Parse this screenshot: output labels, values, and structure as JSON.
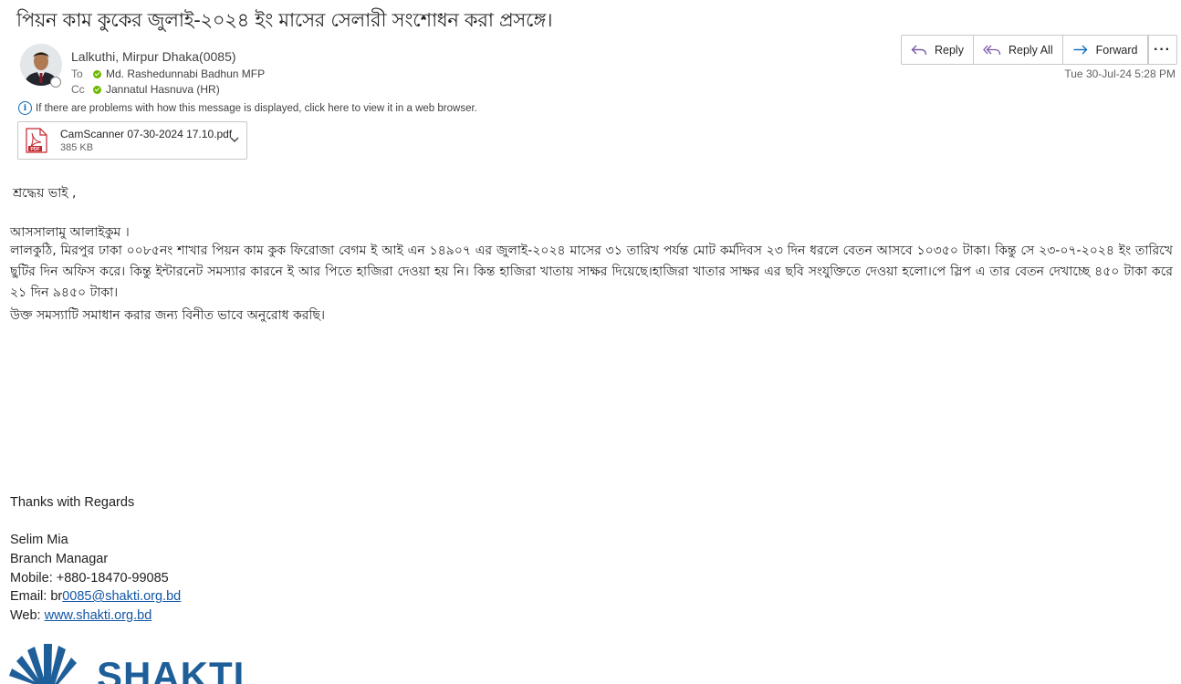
{
  "email": {
    "subject": "পিয়ন কাম কুকের জুলাই-২০২৪ ইং মাসের সেলারী সংশোধন করা প্রসঙ্গে।",
    "sender": "Lalkuthi, Mirpur Dhaka(0085)",
    "to_label": "To",
    "to": "Md. Rashedunnabi Badhun MFP",
    "cc_label": "Cc",
    "cc": "Jannatul Hasnuva (HR)",
    "date": "Tue 30-Jul-24 5:28 PM",
    "info_bar": "If there are problems with how this message is displayed, click here to view it in a web browser."
  },
  "actions": {
    "reply": "Reply",
    "reply_all": "Reply All",
    "forward": "Forward",
    "more": "···"
  },
  "attachment": {
    "name": "CamScanner 07-30-2024 17.10.pdf",
    "size": "385 KB",
    "badge": "PDF"
  },
  "body": {
    "salutation": "শ্রদ্ধেয় ভাই ,",
    "greeting": "আসসালামু আলাইকুম ।",
    "paragraph": "লালকুঠি, মিরপুর ঢাকা ০০৮৫নং শাখার পিয়ন কাম কুক ফিরোজা বেগম ই আই এন ১৪৯০৭ এর জুলাই-২০২৪ মাসের ৩১ তারিখ পর্যন্ত মোট কর্মদিবস ২৩ দিন ধরলে বেতন আসবে ১০৩৫০ টাকা। কিন্তু সে ২৩-০৭-২০২৪ ইং তারিখে ছুটির দিন অফিস করে। কিন্তু ইন্টারনেট সমস্যার কারনে ই আর পিতে হাজিরা দেওয়া হয় নি। কিন্ত হাজিরা খাতায় সাক্ষর দিয়েছে।হাজিরা খাতার সাক্ষর এর ছবি সংযুক্তিতে দেওয়া হলো।পে স্লিপ এ তার বেতন দেখাচ্ছে ৪৫০ টাকা করে ২১ দিন ৯৪৫০ টাকা।",
    "request": "উক্ত সমস্যাটি সমাধান করার জন্য বিনীত ভাবে অনুরোধ করছি।"
  },
  "signature": {
    "closing": "Thanks with Regards",
    "name": "Selim Mia",
    "title": "Branch Managar",
    "mobile": "Mobile: +880-18470-99085",
    "email_label": "Email: br",
    "email_link": "0085@shakti.org.bd",
    "web_label": "Web: ",
    "web_link": "www.shakti.org.bd",
    "logo_text": "SHAKTI"
  },
  "colors": {
    "accent": "#0f6cbd",
    "presence": "#6bb700",
    "link": "#1155a5",
    "pdf_red": "#c4262e",
    "logo_blue": "#1f5f99"
  }
}
